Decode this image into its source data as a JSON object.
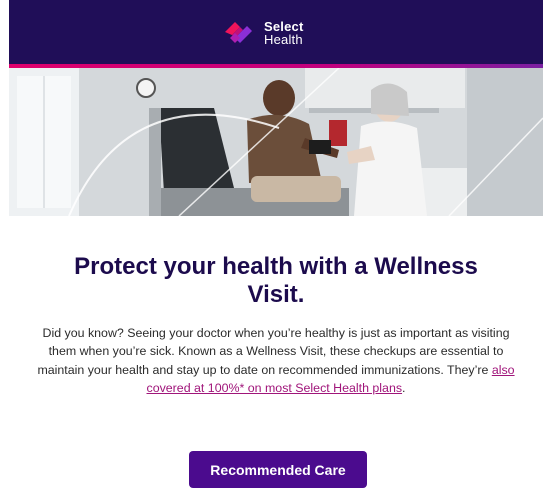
{
  "header": {
    "brand_line1": "Select",
    "brand_line2": "Health",
    "logo_icon": "select-health-logo-icon"
  },
  "hero": {
    "image": "doctor-taking-patient-blood-pressure-photo"
  },
  "main": {
    "headline_line1": "Protect your health with a Wellness",
    "headline_line2": "Visit.",
    "body_text": "Did you know? Seeing your doctor when you’re healthy is just as important as visiting them when you’re sick. Known as a Wellness Visit, these checkups are essential to maintain your health and stay up to date on recommended immunizations. They’re ",
    "link_text": "also covered at 100%* on most Select Health plans",
    "body_end": ".",
    "cta_label": "Recommended Care"
  },
  "colors": {
    "header_bg": "#200e58",
    "accent_pink": "#e0006c",
    "headline": "#1c0b4d",
    "link": "#a0157a",
    "button_bg": "#4b0b8e"
  }
}
